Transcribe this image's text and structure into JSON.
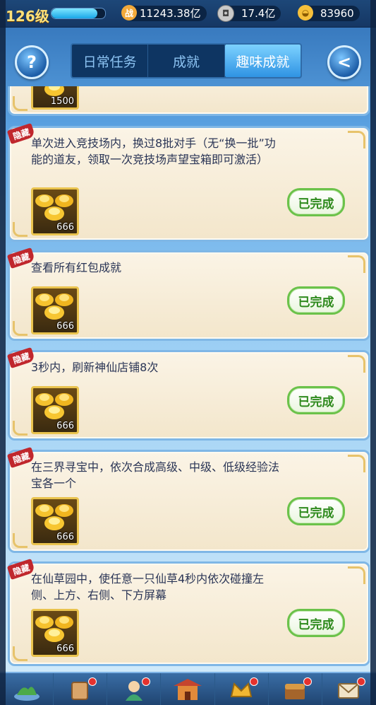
{
  "status": {
    "level": "126级",
    "xp_progress": 0.85,
    "power_icon": "zhan-power-icon",
    "power": "11243.38亿",
    "coin_icon": "copper-coin-icon",
    "coins": "17.4亿",
    "ingot_icon": "gold-ingot-icon",
    "ingots": "83960"
  },
  "header": {
    "help_label": "?",
    "back_label": "<",
    "tabs": [
      {
        "label": "日常任务",
        "active": false
      },
      {
        "label": "成就",
        "active": false
      },
      {
        "label": "趣味成就",
        "active": true
      }
    ]
  },
  "achievements": [
    {
      "hidden": false,
      "hidden_tag": "",
      "description": "",
      "reward_icon": "gold-ingots-icon",
      "reward_count": "1500",
      "status": ""
    },
    {
      "hidden": true,
      "hidden_tag": "隐藏",
      "description": "单次进入竞技场内，换过8批对手（无“换一批”功能的道友，领取一次竞技场声望宝箱即可激活）",
      "reward_icon": "gold-ingots-icon",
      "reward_count": "666",
      "status": "已完成"
    },
    {
      "hidden": true,
      "hidden_tag": "隐藏",
      "description": "查看所有红包成就",
      "reward_icon": "gold-ingots-icon",
      "reward_count": "666",
      "status": "已完成"
    },
    {
      "hidden": true,
      "hidden_tag": "隐藏",
      "description": "3秒内，刷新神仙店铺8次",
      "reward_icon": "gold-ingots-icon",
      "reward_count": "666",
      "status": "已完成"
    },
    {
      "hidden": true,
      "hidden_tag": "隐藏",
      "description": "在三界寻宝中，依次合成高级、中级、低级经验法宝各一个",
      "reward_icon": "gold-ingots-icon",
      "reward_count": "666",
      "status": "已完成"
    },
    {
      "hidden": true,
      "hidden_tag": "隐藏",
      "description": "在仙草园中，使任意一只仙草4秒内依次碰撞左侧、上方、右侧、下方屏幕",
      "reward_icon": "gold-ingots-icon",
      "reward_count": "666",
      "status": "已完成"
    }
  ],
  "bottom_nav": [
    {
      "icon": "island-icon",
      "badge": false
    },
    {
      "icon": "scroll-icon",
      "badge": true
    },
    {
      "icon": "character-icon",
      "badge": true
    },
    {
      "icon": "pavilion-icon",
      "badge": false
    },
    {
      "icon": "crown-icon",
      "badge": true
    },
    {
      "icon": "treasure-icon",
      "badge": true
    },
    {
      "icon": "mail-icon",
      "badge": true
    }
  ],
  "colors": {
    "accent_tab": "#2f93e3",
    "hidden_tag": "#c0272d",
    "done_green": "#2e8a1d",
    "gold": "#e9c34e"
  }
}
